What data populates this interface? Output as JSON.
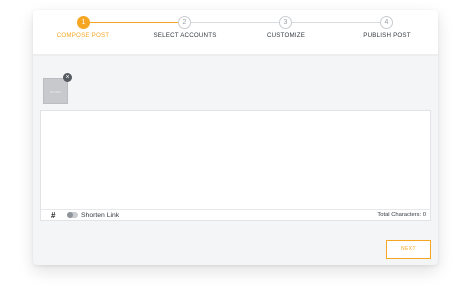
{
  "stepper": {
    "steps": [
      {
        "number": "1",
        "label": "COMPOSE POST",
        "state": "active"
      },
      {
        "number": "2",
        "label": "SELECT ACCOUNTS",
        "state": "pending"
      },
      {
        "number": "3",
        "label": "CUSTOMIZE",
        "state": "pending"
      },
      {
        "number": "4",
        "label": "PUBLISH POST",
        "state": "pending"
      }
    ]
  },
  "media": {
    "thumbnail_text": "NO IMG",
    "remove_icon": "×"
  },
  "editor": {
    "text": ""
  },
  "footer": {
    "hash_icon": "#",
    "shorten_link_label": "Shorten Link",
    "shorten_link_enabled": false,
    "total_characters_label": "Total Characters: 0"
  },
  "actions": {
    "next_label": "NEXT"
  },
  "colors": {
    "accent": "#f5a623",
    "panel_bg": "#f4f5f6"
  }
}
